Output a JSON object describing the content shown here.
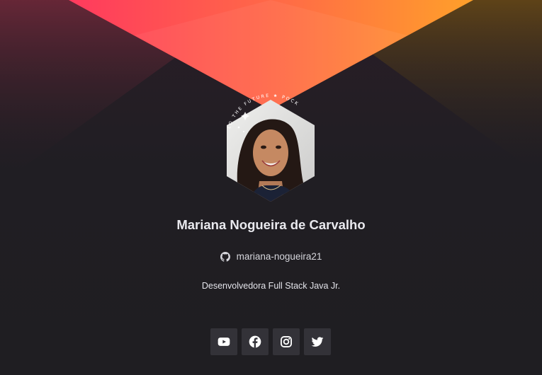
{
  "profile": {
    "name": "Mariana Nogueira de Carvalho",
    "github_username": "mariana-nogueira21",
    "bio": "Desenvolvedora Full Stack Java Jr.",
    "badge_text": "LO THE FUTURE ★ POCK",
    "avatar_alt": "Profile photo"
  },
  "socials": [
    {
      "name": "youtube",
      "icon": "youtube-icon"
    },
    {
      "name": "facebook",
      "icon": "facebook-icon"
    },
    {
      "name": "instagram",
      "icon": "instagram-icon"
    },
    {
      "name": "twitter",
      "icon": "twitter-icon"
    }
  ],
  "colors": {
    "background": "#1f1e22",
    "triangle_left": "#ff3b5c",
    "triangle_right": "#ff9a2a",
    "social_button_bg": "#333238",
    "text": "#e9e9ee"
  }
}
